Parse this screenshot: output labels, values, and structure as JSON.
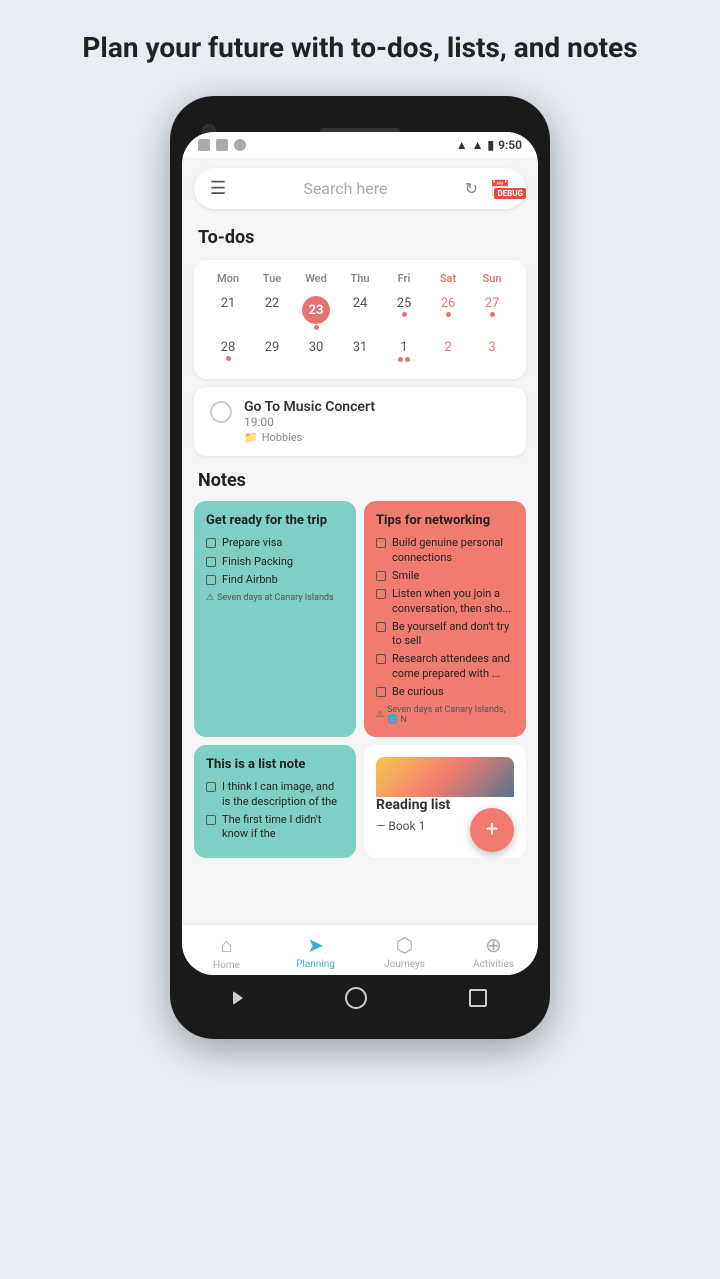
{
  "headline": "Plan your future with to-dos,\nlists, and notes",
  "status": {
    "time": "9:50",
    "debug": "DEBUG"
  },
  "search": {
    "placeholder": "Search here"
  },
  "todos": {
    "label": "To-dos",
    "calendar": {
      "day_names": [
        "Mon",
        "Tue",
        "Wed",
        "Thu",
        "Fri",
        "Sat",
        "Sun"
      ],
      "week1": [
        {
          "num": "21",
          "type": "normal"
        },
        {
          "num": "22",
          "type": "normal"
        },
        {
          "num": "23",
          "type": "today"
        },
        {
          "num": "24",
          "type": "normal"
        },
        {
          "num": "25",
          "type": "normal",
          "dot": true
        },
        {
          "num": "26",
          "type": "weekend",
          "dot": true
        },
        {
          "num": "27",
          "type": "weekend",
          "dot": true
        }
      ],
      "week2": [
        {
          "num": "28",
          "type": "normal",
          "dot": true
        },
        {
          "num": "29",
          "type": "normal"
        },
        {
          "num": "30",
          "type": "normal"
        },
        {
          "num": "31",
          "type": "normal"
        },
        {
          "num": "1",
          "type": "next",
          "dots": 2
        },
        {
          "num": "2",
          "type": "next-weekend"
        },
        {
          "num": "3",
          "type": "next-weekend"
        }
      ]
    },
    "todo_item": {
      "title": "Go To Music Concert",
      "time": "19:00",
      "tag": "Hobbies"
    }
  },
  "notes": {
    "label": "Notes",
    "card1": {
      "title": "Get ready for the trip",
      "items": [
        "Prepare visa",
        "Finish Packing",
        "Find Airbnb"
      ],
      "footer": "Seven days at Canary Islands"
    },
    "card2": {
      "title": "Tips for networking",
      "items": [
        "Build genuine personal connections",
        "Smile",
        "Listen when you join a conversation, then sho...",
        "Be yourself and don't try to sell",
        "Research attendees and come prepared with ...",
        "Be curious"
      ],
      "footer": "Seven days at Canary Islands, 🌐 N"
    },
    "card3": {
      "title": "This is a list note",
      "items": [
        "I think I can image, and is the description of the",
        "The first time I didn't know if the"
      ]
    },
    "card4": {
      "title": "Reading list",
      "items": [
        "Book 1"
      ]
    }
  },
  "fab": "+",
  "nav": {
    "items": [
      {
        "label": "Home",
        "icon": "⌂",
        "active": false
      },
      {
        "label": "Planning",
        "icon": "✈",
        "active": true
      },
      {
        "label": "Journeys",
        "icon": "⛉",
        "active": false
      },
      {
        "label": "Activities",
        "icon": "⊕",
        "active": false
      }
    ]
  }
}
